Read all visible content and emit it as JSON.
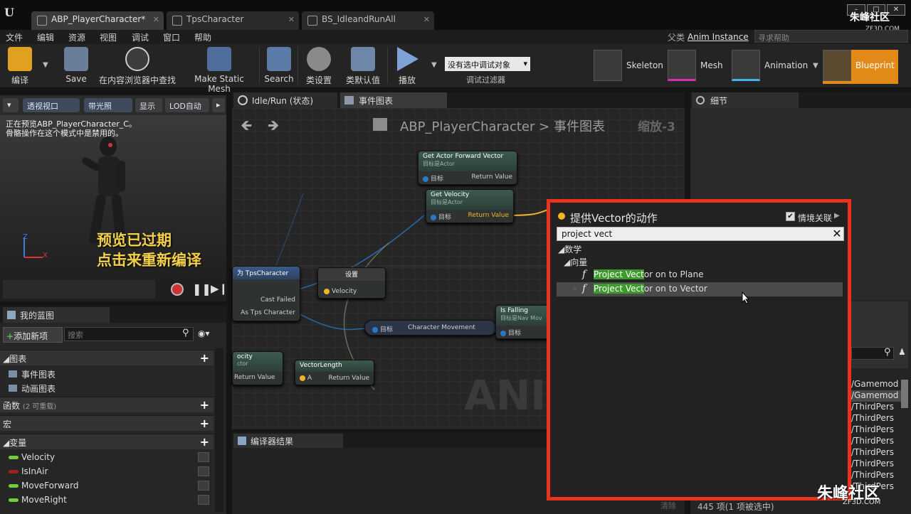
{
  "tabs": [
    {
      "label": "ABP_PlayerCharacter*"
    },
    {
      "label": "TpsCharacter"
    },
    {
      "label": "BS_IdleandRunAll"
    }
  ],
  "brand": {
    "name": "朱峰社区",
    "url": "ZF3D.COM"
  },
  "menu": [
    "文件",
    "编辑",
    "资源",
    "视图",
    "调试",
    "窗口",
    "帮助"
  ],
  "parent_class": {
    "label": "父类",
    "value": "Anim Instance"
  },
  "help_search": {
    "placeholder": "寻求帮助"
  },
  "toolbar": {
    "compile": "编译",
    "save": "Save",
    "find_in_cb": "在内容浏览器中查找",
    "make_static_mesh": "Make Static Mesh",
    "search": "Search",
    "class_settings": "类设置",
    "class_defaults": "类默认值",
    "play": "播放",
    "debug_select": "没有选中调试对象",
    "debug_filter": "调试过滤器"
  },
  "modes": {
    "skeleton": "Skeleton",
    "mesh": "Mesh",
    "animation": "Animation",
    "blueprint": "Blueprint"
  },
  "viewport": {
    "buttons": [
      "透视视口",
      "带光照",
      "显示",
      "LOD自动"
    ],
    "msg1": "正在预览ABP_PlayerCharacter_C。",
    "msg2": "骨骼操作在这个模式中是禁用的。",
    "warn1": "预览已过期",
    "warn2": "点击来重新编译",
    "axis_z": "Z",
    "axis_x": "X"
  },
  "my_blueprint": {
    "tab": "我的蓝图",
    "add_new": "添加新项",
    "search_placeholder": "搜索",
    "sections": {
      "graphs": "图表",
      "event_graph": "事件图表",
      "anim_graph": "动画图表",
      "functions": "函数",
      "functions_note": "(2 可重载)",
      "macros": "宏",
      "variables": "变量"
    },
    "variables": [
      {
        "name": "Velocity",
        "color": "#6fcf3a"
      },
      {
        "name": "IsInAir",
        "color": "#a02020"
      },
      {
        "name": "MoveForward",
        "color": "#6fcf3a"
      },
      {
        "name": "MoveRight",
        "color": "#6fcf3a"
      }
    ]
  },
  "graph_tabs": {
    "idle_run": "Idle/Run (状态)",
    "event_graph": "事件图表"
  },
  "graph": {
    "breadcrumb_root": "ABP_PlayerCharacter",
    "breadcrumb_sep": ">",
    "breadcrumb_leaf": "事件图表",
    "zoom": "缩放-3",
    "watermark": "ANIM"
  },
  "nodes": {
    "forward": {
      "title": "Get Actor Forward Vector",
      "sub": "目标是Actor",
      "in": "目标",
      "out": "Return Value"
    },
    "velocity": {
      "title": "Get Velocity",
      "sub": "目标是Actor",
      "in": "目标",
      "out": "Return Value"
    },
    "cast": {
      "title": "为 TpsCharacter",
      "failed": "Cast Failed",
      "as": "As Tps Character"
    },
    "set": {
      "title": "设置",
      "pin": "Velocity"
    },
    "movement": {
      "in": "目标",
      "label": "Character Movement"
    },
    "falling": {
      "title": "Is Falling",
      "sub": "目标是Nav Mov",
      "in": "目标"
    },
    "velocity2": {
      "title": "ocity",
      "sub": "ctor",
      "out": "Return Value"
    },
    "vlen": {
      "title": "VectorLength",
      "in": "A",
      "out": "Return Value"
    }
  },
  "compiler": {
    "tab": "编译器结果",
    "clear": "清除"
  },
  "details": {
    "tab": "细节"
  },
  "assets": {
    "rows": [
      "/Gamemod",
      "/Gamemod",
      "/ThirdPers",
      "/ThirdPers",
      "/ThirdPers",
      "/ThirdPers",
      "/ThirdPers",
      "/ThirdPers",
      "/ThirdPers",
      "/ThirdPers"
    ],
    "count": "445 项(1 项被选中)"
  },
  "action_menu": {
    "title": "提供Vector的动作",
    "context_label": "情境关联",
    "search_value": "project vect",
    "category": "数学",
    "subcategory": "向量",
    "results": [
      {
        "match": "Project Vect",
        "rest": "or on to Plane"
      },
      {
        "match": "Project Vect",
        "rest": "or on to Vector"
      }
    ]
  }
}
